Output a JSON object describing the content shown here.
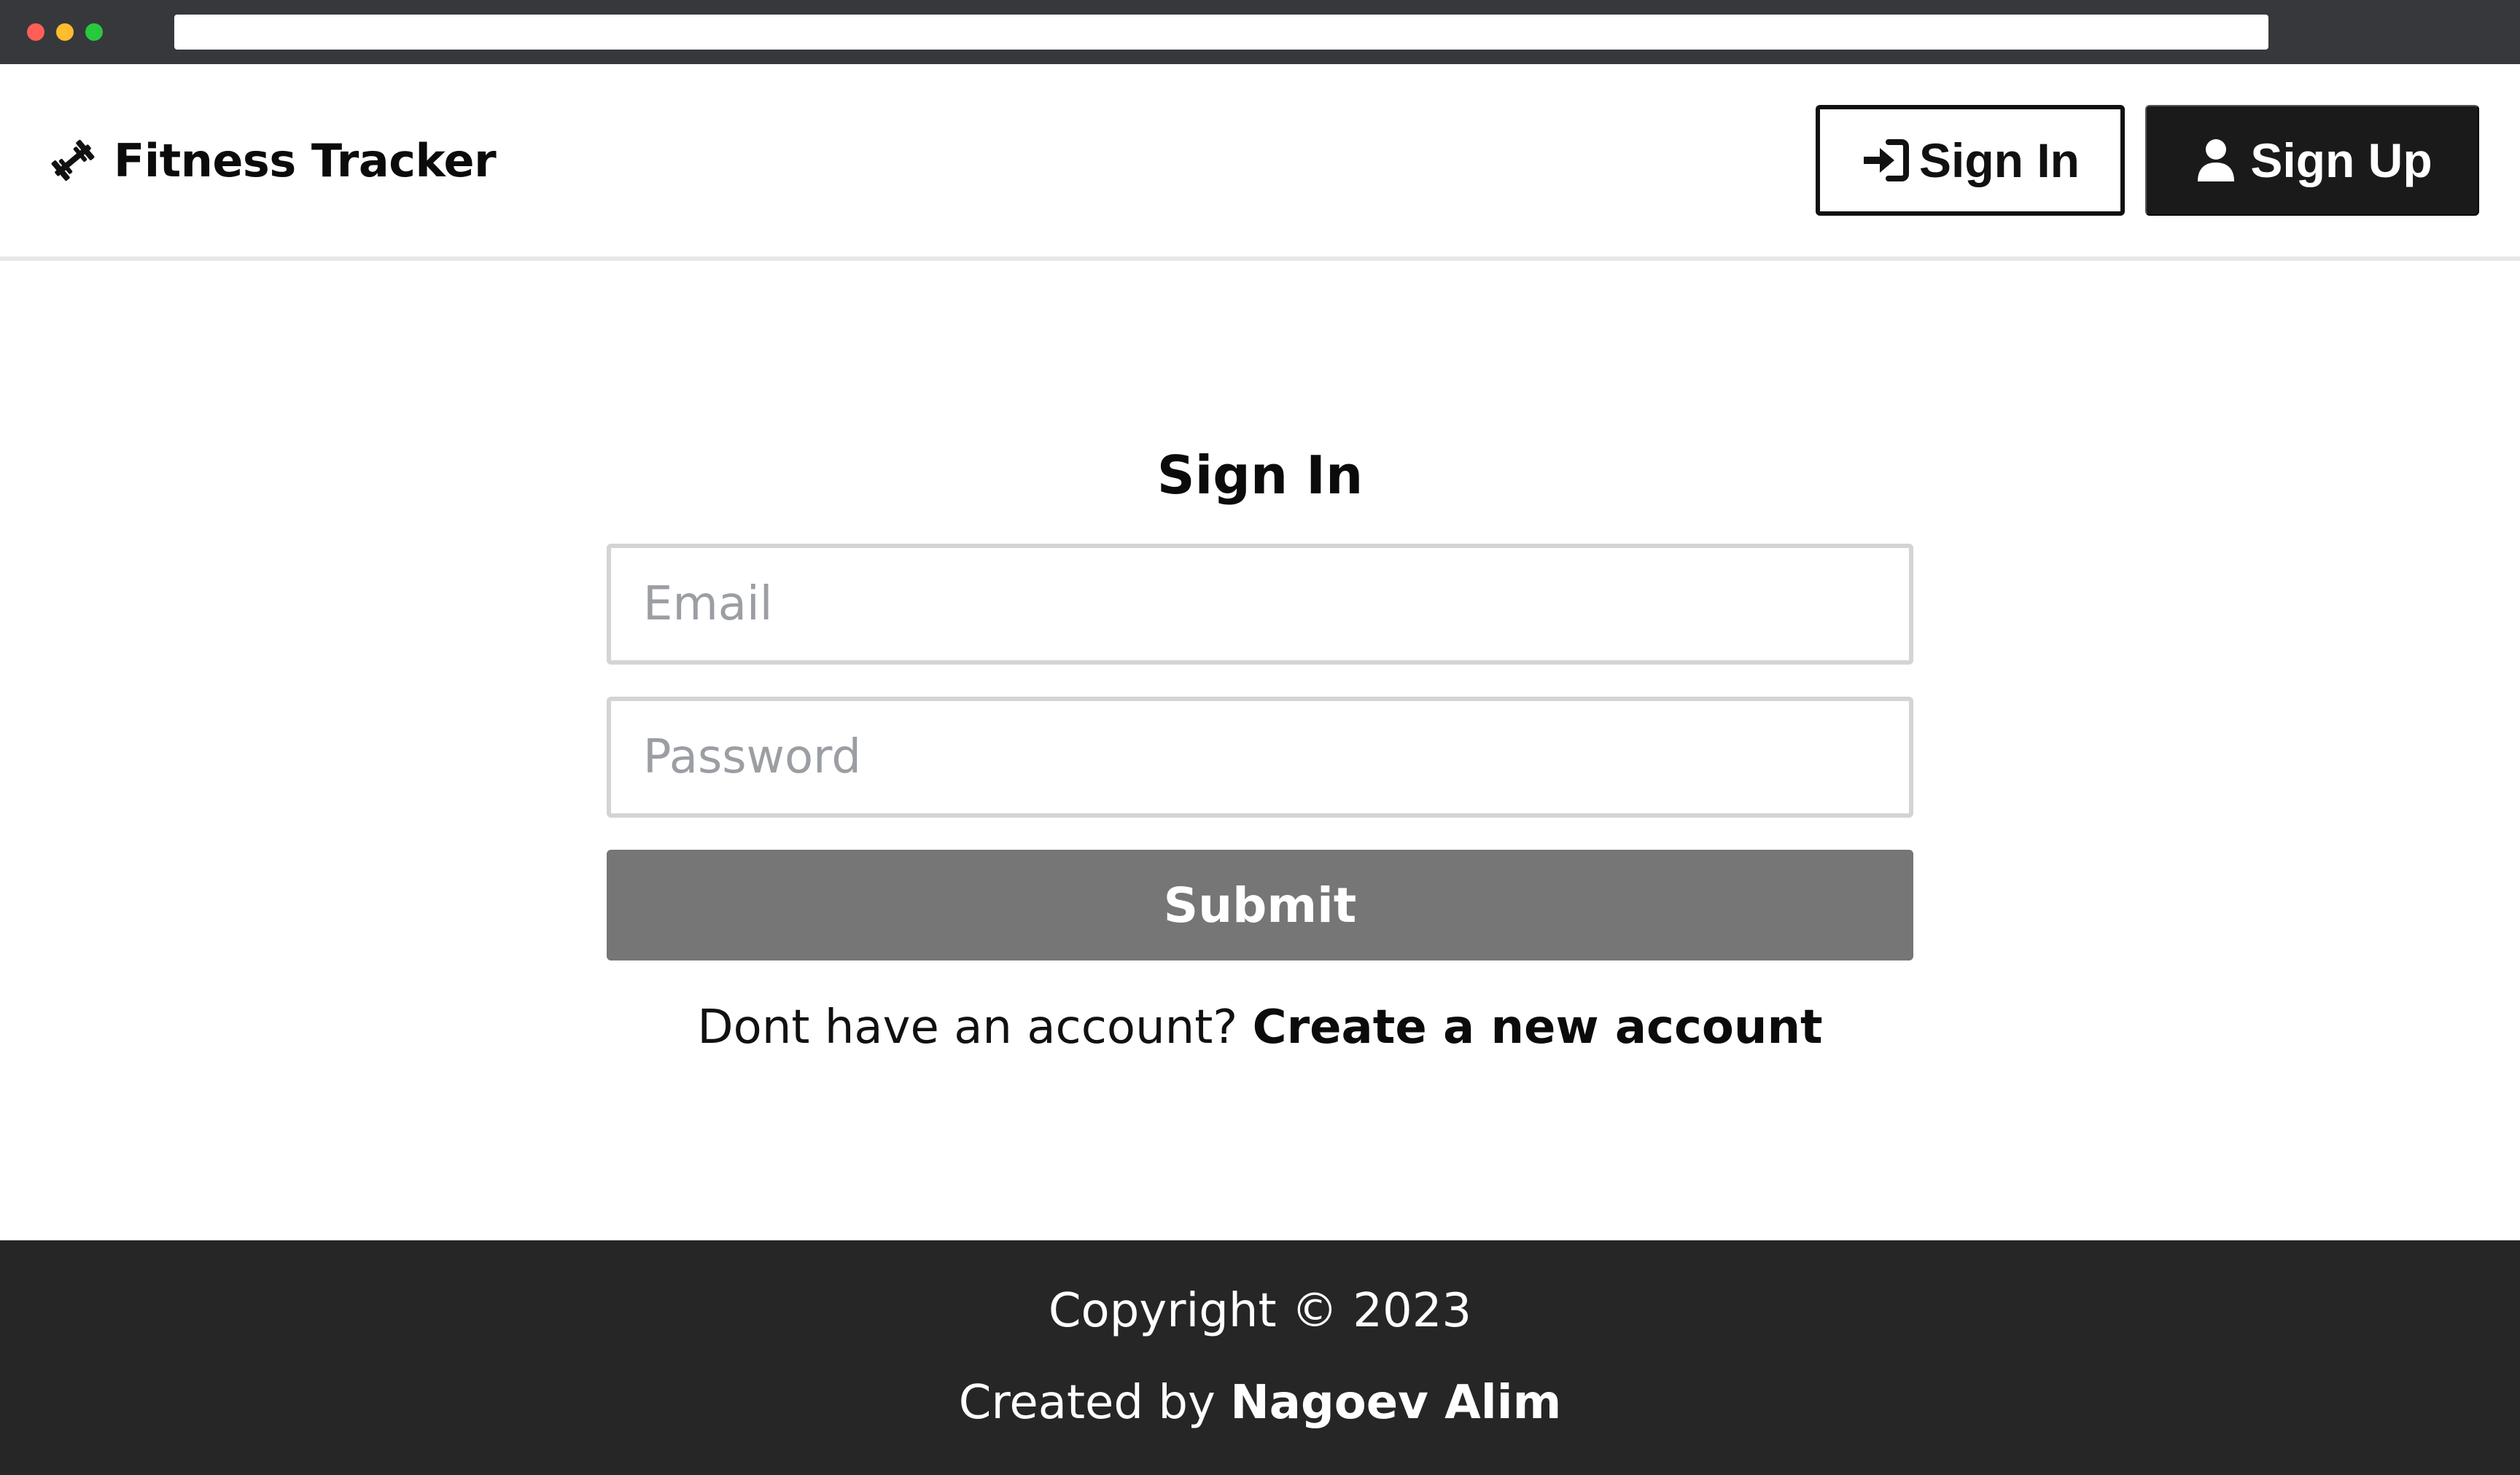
{
  "colors": {
    "chrome_bg": "#37383b",
    "traffic_red": "#ff5f57",
    "traffic_yellow": "#febc2e",
    "traffic_green": "#28c840",
    "primary_dark": "#1a1a1a",
    "submit_bg": "#767676",
    "footer_bg": "#262626",
    "input_border": "#d4d4d4",
    "placeholder": "#9b9ea3"
  },
  "browser": {
    "traffic_lights": [
      "close",
      "minimize",
      "maximize"
    ]
  },
  "header": {
    "brand": {
      "icon": "dumbbell-icon",
      "title": "Fitness Tracker"
    },
    "sign_in": {
      "icon": "sign-in-icon",
      "label": "Sign In"
    },
    "sign_up": {
      "icon": "user-icon",
      "label": "Sign Up"
    }
  },
  "form": {
    "title": "Sign In",
    "email": {
      "value": "",
      "placeholder": "Email"
    },
    "password": {
      "value": "",
      "placeholder": "Password"
    },
    "submit_label": "Submit",
    "prompt_text": "Dont have an account?",
    "create_account_link": "Create a new account"
  },
  "footer": {
    "copyright": "Copyright © 2023",
    "created_by": "Created by",
    "author": "Nagoev Alim"
  }
}
